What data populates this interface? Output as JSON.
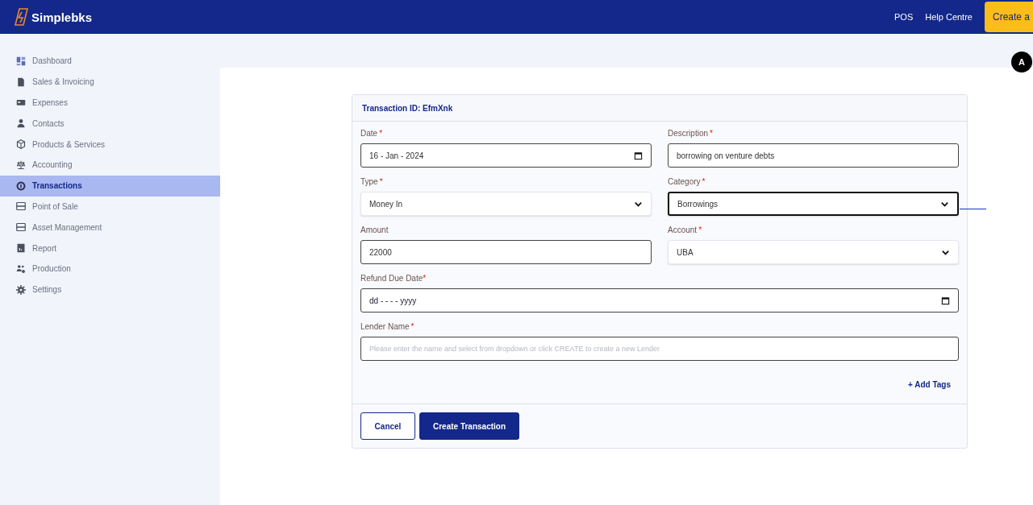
{
  "header": {
    "brand": "Simplebks",
    "links": [
      "POS",
      "Help Centre"
    ],
    "cta": "Create a"
  },
  "avatar": {
    "initial": "A"
  },
  "sidebar": {
    "items": [
      {
        "label": "Dashboard",
        "selected": false
      },
      {
        "label": "Sales & Invoicing",
        "selected": false
      },
      {
        "label": "Expenses",
        "selected": false
      },
      {
        "label": "Contacts",
        "selected": false
      },
      {
        "label": "Products & Services",
        "selected": false
      },
      {
        "label": "Accounting",
        "selected": false
      },
      {
        "label": "Transactions",
        "selected": true
      },
      {
        "label": "Point of Sale",
        "selected": false
      },
      {
        "label": "Asset Management",
        "selected": false
      },
      {
        "label": "Report",
        "selected": false
      },
      {
        "label": "Production",
        "selected": false
      },
      {
        "label": "Settings",
        "selected": false
      }
    ]
  },
  "form": {
    "title": "Transaction ID: EfmXnk",
    "rows": [
      [
        {
          "label": "Date",
          "mark": "*",
          "kind": "date",
          "value": "16 - Jan - 2024",
          "focused": false
        },
        {
          "label": "Description",
          "mark": "*",
          "kind": "text",
          "value": "borrowing on venture debts",
          "focused": false
        }
      ],
      [
        {
          "label": "Type",
          "mark": "*",
          "kind": "select",
          "value": "Money In",
          "focused": false
        },
        {
          "label": "Category",
          "mark": "*",
          "kind": "select",
          "value": "Borrowings",
          "focused": true
        }
      ],
      [
        {
          "label": "Amount",
          "kind": "text",
          "value": "22000",
          "focused": false
        },
        {
          "label": "Account",
          "mark": "*",
          "kind": "select",
          "value": "UBA",
          "focused": false
        }
      ],
      [
        {
          "label": "Refund Due Date",
          "mark": "*",
          "kind": "date",
          "placeholder": "dd - - - - yyyy",
          "focused": false
        }
      ],
      [
        {
          "label": "Lender Name",
          "mark": "*",
          "kind": "text",
          "placeholder": "Please enter the name and select from dropdown or click CREATE to create a new Lender",
          "focused": false
        }
      ]
    ],
    "add_tags": "+ Add Tags",
    "buttons": [
      {
        "label": "Cancel",
        "kind": "outline"
      },
      {
        "label": "Create Transaction",
        "kind": "primary"
      }
    ]
  }
}
